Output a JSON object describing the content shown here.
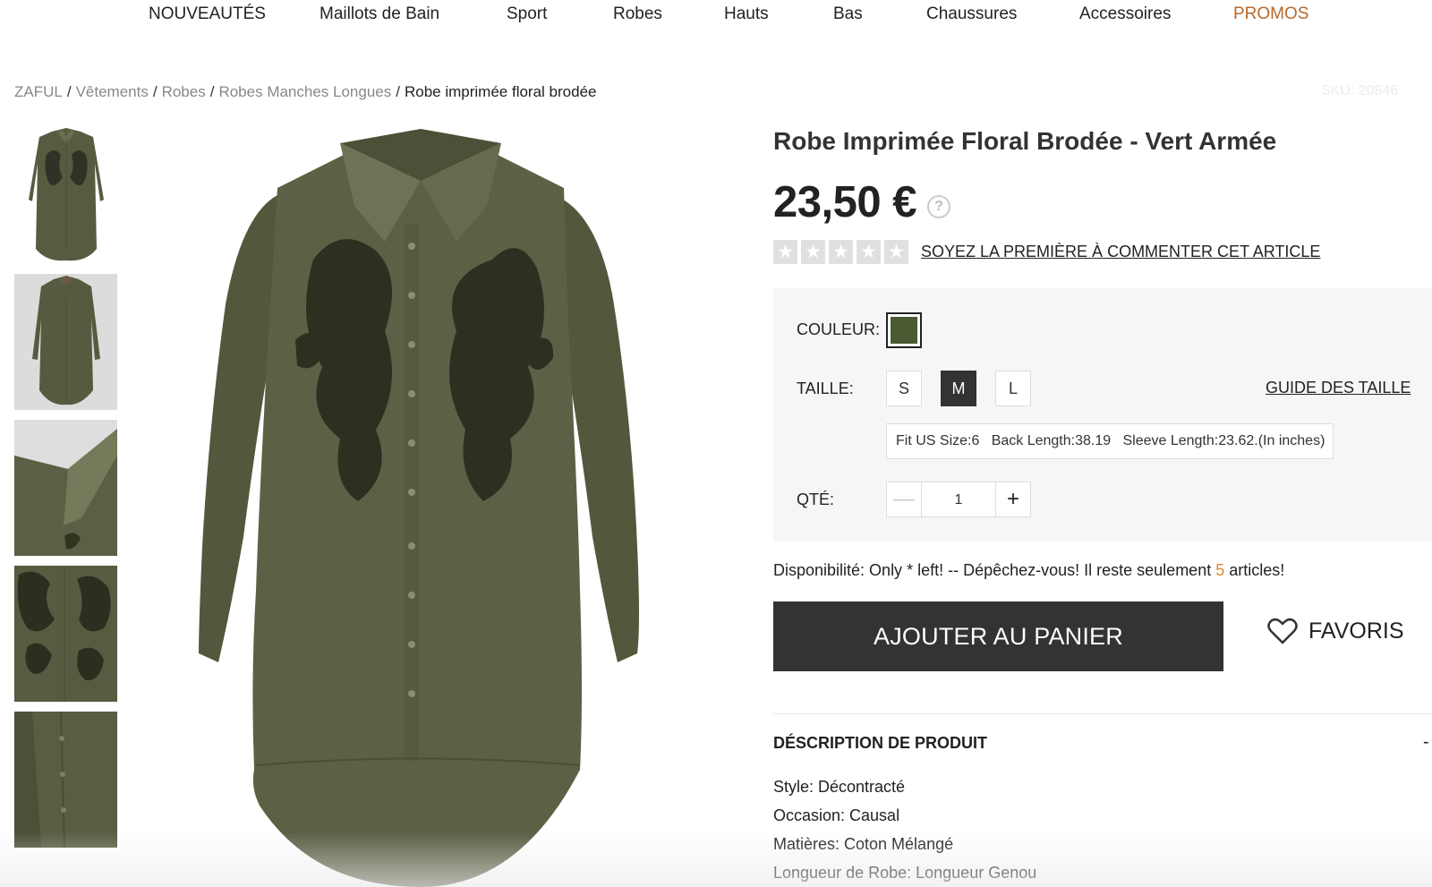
{
  "nav": {
    "items": [
      {
        "label": "NOUVEAUTÉS"
      },
      {
        "label": "Maillots de Bain"
      },
      {
        "label": "Sport"
      },
      {
        "label": "Robes"
      },
      {
        "label": "Hauts"
      },
      {
        "label": "Bas"
      },
      {
        "label": "Chaussures"
      },
      {
        "label": "Accessoires"
      },
      {
        "label": "PROMOS",
        "highlight": true,
        "color": "#b8692b"
      }
    ]
  },
  "breadcrumb": {
    "items": [
      "ZAFUL",
      "Vêtements",
      "Robes",
      "Robes Manches Longues"
    ],
    "separator": "/",
    "current": "Robe imprimée floral brodée"
  },
  "sku": "SKU: 20846",
  "gallery": {
    "thumbnails": [
      {
        "icon": "front-view-thumbnail"
      },
      {
        "icon": "back-view-thumbnail"
      },
      {
        "icon": "collar-detail-thumbnail"
      },
      {
        "icon": "embroidery-detail-thumbnail"
      },
      {
        "icon": "buttons-detail-thumbnail"
      }
    ],
    "main_icon": "dress-main-image"
  },
  "product": {
    "title": "Robe Imprimée Floral Brodée - Vert Armée",
    "price": "23,50 €",
    "help_icon": "?",
    "rating_stars": 0,
    "review_link": "SOYEZ LA PREMIÈRE À COMMENTER CET ARTICLE",
    "color_label": "COULEUR:",
    "color_swatch": "#4a5a32",
    "size_label": "TAILLE:",
    "sizes": [
      "S",
      "M",
      "L"
    ],
    "selected_size": "M",
    "size_guide": "GUIDE DES TAILLE",
    "size_info": "Fit US Size:6   Back Length:38.19   Sleeve Length:23.62.(In inches)",
    "qty_label": "QTÉ:",
    "qty_value": "1",
    "qty_minus": "—",
    "qty_plus": "+",
    "availability_prefix": "Disponibilité: Only * left! -- Dépêchez-vous! Il reste seulement ",
    "availability_count": "5",
    "availability_suffix": " articles!",
    "add_to_cart": "AJOUTER AU PANIER",
    "favorites": "FAVORIS"
  },
  "description": {
    "heading": "DÉSCRIPTION DE PRODUIT",
    "toggle": "-",
    "lines": [
      "Style: Décontracté",
      "Occasion: Causal",
      "Matières: Coton Mélangé",
      "Longueur de Robe: Longueur Genou"
    ]
  },
  "colors": {
    "accent_promo": "#b8692b",
    "stock_count": "#e08a2b",
    "button_dark": "#333333",
    "fabric_green": "#5a5f42"
  }
}
